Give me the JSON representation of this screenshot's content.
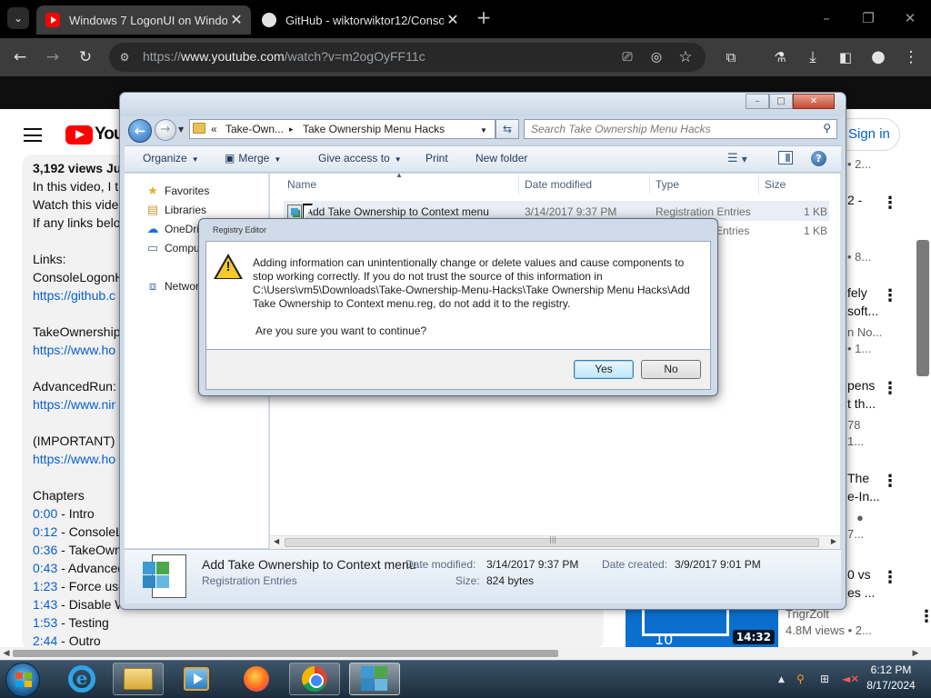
{
  "browser": {
    "tabs": [
      {
        "title": "Windows 7 LogonUI on Windo",
        "favicon": "youtube-icon",
        "active": true
      },
      {
        "title": "GitHub - wiktorwiktor12/Conso",
        "favicon": "github-icon",
        "active": false
      }
    ],
    "url_prefix": "https://",
    "url_host": "www.youtube.com",
    "url_path": "/watch?v=m2ogOyFF11c",
    "icons": [
      "tab-list-icon",
      "back-icon",
      "forward-icon",
      "reload-icon",
      "site-info-icon",
      "install-app-icon",
      "eye-off-icon",
      "bookmark-star-icon",
      "extensions-icon",
      "labs-flask-icon",
      "download-icon",
      "side-panel-icon",
      "profile-icon",
      "more-menu-icon"
    ]
  },
  "youtube": {
    "logo_text": "You",
    "signin": "Sign in",
    "description_lines": [
      {
        "text": "3,192 views  Ju",
        "style": "bold"
      },
      {
        "text": "In this video, I t",
        "style": "plain"
      },
      {
        "text": "Watch this vide",
        "style": "plain"
      },
      {
        "text": "If any links belo",
        "style": "plain"
      },
      {
        "text": "Links:",
        "style": "plain"
      },
      {
        "text": "ConsoleLogonH",
        "style": "plain"
      },
      {
        "text": "https://github.c",
        "style": "link"
      },
      {
        "text": "TakeOwnership",
        "style": "plain"
      },
      {
        "text": "https://www.ho",
        "style": "link"
      },
      {
        "text": "AdvancedRun:",
        "style": "plain"
      },
      {
        "text": "https://www.nir",
        "style": "link"
      },
      {
        "text": "(IMPORTANT) D",
        "style": "plain"
      },
      {
        "text": "https://www.ho",
        "style": "link"
      },
      {
        "text": "Chapters",
        "style": "plain"
      }
    ],
    "chapters": [
      {
        "time": "0:00",
        "title": " - Intro"
      },
      {
        "time": "0:12",
        "title": " - ConsoleL"
      },
      {
        "time": "0:36",
        "title": " - TakeOwn"
      },
      {
        "time": "0:43",
        "title": " - Advanced"
      },
      {
        "time": "1:23",
        "title": " - Force use"
      },
      {
        "time": "1:43",
        "title": " - Disable W"
      },
      {
        "time": "1:53",
        "title": " - Testing"
      },
      {
        "time": "2:44",
        "title": " - Outro"
      }
    ],
    "sidebar_fragments": [
      {
        "text": "• 2...",
        "kind": "meta"
      },
      {
        "text": "2 -",
        "kind": "title"
      },
      {
        "text": "• 8...",
        "kind": "meta"
      },
      {
        "text": "fely",
        "kind": "title"
      },
      {
        "text": "soft...",
        "kind": "title"
      },
      {
        "text": "n No...",
        "kind": "meta"
      },
      {
        "text": "• 1...",
        "kind": "meta"
      },
      {
        "text": "pens",
        "kind": "title"
      },
      {
        "text": "t th...",
        "kind": "title"
      },
      {
        "text": "78",
        "kind": "meta"
      },
      {
        "text": "1...",
        "kind": "meta"
      },
      {
        "text": "The",
        "kind": "title"
      },
      {
        "text": "e-In...",
        "kind": "title"
      },
      {
        "text": "7...",
        "kind": "meta"
      },
      {
        "text": "0 vs",
        "kind": "title"
      },
      {
        "text": "es ...",
        "kind": "title"
      },
      {
        "text": "TrigrZolt",
        "kind": "meta"
      },
      {
        "text": "4.8M views  • 2...",
        "kind": "meta"
      }
    ],
    "thumbnail": {
      "number": "10",
      "duration": "14:32"
    }
  },
  "explorer": {
    "breadcrumb": [
      "«",
      "Take-Own...",
      "▸",
      "Take Ownership Menu Hacks"
    ],
    "search_placeholder": "Search Take Ownership Menu Hacks",
    "commands": [
      {
        "label": "Organize",
        "dropdown": true
      },
      {
        "label": "Merge",
        "dropdown": true
      },
      {
        "label": "Give access to",
        "dropdown": true
      },
      {
        "label": "Print",
        "dropdown": false
      },
      {
        "label": "New folder",
        "dropdown": false
      }
    ],
    "nav": [
      {
        "label": "Favorites",
        "icon": "star-icon"
      },
      {
        "label": "Libraries",
        "icon": "libraries-icon"
      },
      {
        "label": "OneDri",
        "icon": "onedrive-icon"
      },
      {
        "label": "Compu",
        "icon": "computer-icon"
      },
      {
        "label": "Networ",
        "icon": "network-icon"
      }
    ],
    "columns": [
      "Name",
      "Date modified",
      "Type",
      "Size"
    ],
    "files": [
      {
        "name": "Add Take Ownership to Context menu",
        "date": "3/14/2017 9:37 PM",
        "type": "Registration Entries",
        "size": "1 KB"
      },
      {
        "name": "",
        "date": "",
        "type": "Entries",
        "size": "1 KB"
      }
    ],
    "details": {
      "name": "Add Take Ownership to Context menu",
      "type": "Registration Entries",
      "modified_label": "Date modified:",
      "modified": "3/14/2017 9:37 PM",
      "created_label": "Date created:",
      "created": "3/9/2017 9:01 PM",
      "size_label": "Size:",
      "size": "824 bytes"
    }
  },
  "dialog": {
    "title": "Registry Editor",
    "message_lines": [
      "Adding information can unintentionally change or delete values and cause components to",
      "stop working correctly. If you do not trust the source of this information in",
      "C:\\Users\\vm5\\Downloads\\Take-Ownership-Menu-Hacks\\Take Ownership Menu Hacks\\Add",
      "Take Ownership to Context menu.reg, do not add it to the registry."
    ],
    "confirm": "Are you sure you want to continue?",
    "yes": "Yes",
    "no": "No",
    "warn_mark": "!"
  },
  "taskbar": {
    "items": [
      {
        "name": "internet-explorer",
        "state": "pinned"
      },
      {
        "name": "windows-explorer",
        "state": "running"
      },
      {
        "name": "media-player",
        "state": "pinned"
      },
      {
        "name": "firefox",
        "state": "pinned"
      },
      {
        "name": "chrome",
        "state": "running"
      },
      {
        "name": "registry-editor",
        "state": "active"
      }
    ],
    "time": "6:12 PM",
    "date": "8/17/2024"
  }
}
